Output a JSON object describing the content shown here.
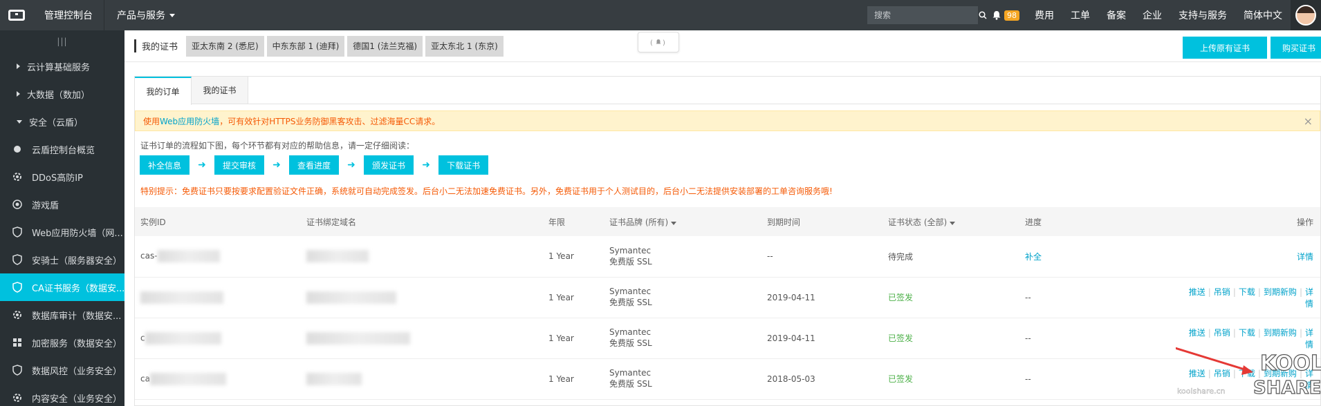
{
  "topbar": {
    "console": "管理控制台",
    "products": "产品与服务",
    "search_placeholder": "搜索",
    "notif_count": "98",
    "links": [
      "费用",
      "工单",
      "备案",
      "企业",
      "支持与服务",
      "简体中文"
    ]
  },
  "sidebar": {
    "collapse": "|||",
    "groups": [
      "云计算基础服务",
      "大数据（数加）",
      "安全（云盾）"
    ],
    "items": [
      {
        "label": "云盾控制台概览",
        "icon": "dot-icon"
      },
      {
        "label": "DDoS高防IP",
        "icon": "gear-icon"
      },
      {
        "label": "游戏盾",
        "icon": "eye-icon"
      },
      {
        "label": "Web应用防火墙（网...",
        "icon": "shield-icon"
      },
      {
        "label": "安骑士（服务器安全）",
        "icon": "shield-icon"
      },
      {
        "label": "CA证书服务（数据安...",
        "icon": "shield-icon"
      },
      {
        "label": "数据库审计（数据安...",
        "icon": "gear-icon"
      },
      {
        "label": "加密服务（数据安全）",
        "icon": "grid-icon"
      },
      {
        "label": "数据风控（业务安全）",
        "icon": "shield-icon"
      },
      {
        "label": "内容安全（业务安全）",
        "icon": "gear-icon"
      }
    ]
  },
  "header": {
    "title": "我的证书",
    "regions": [
      "亚太东南 2 (悉尼)",
      "中东东部 1 (迪拜)",
      "德国1 (法兰克福)",
      "亚太东北 1 (东京)"
    ],
    "upload_btn": "上传原有证书",
    "buy_btn": "购买证书"
  },
  "tabs": [
    "我的订单",
    "我的证书"
  ],
  "warn": {
    "pre": "使用",
    "link": "Web应用防火墙",
    "post": "，可有效针对HTTPS业务防御黑客攻击、过滤海量CC请求。"
  },
  "flow": {
    "desc": "证书订单的流程如下图，每个环节都有对应的帮助信息，请一定仔细阅读：",
    "steps": [
      "补全信息",
      "提交审核",
      "查看进度",
      "颁发证书",
      "下载证书"
    ]
  },
  "tip": "特别提示：免费证书只要按要求配置验证文件正确，系统就可自动完成签发。后台小二无法加速免费证书。另外，免费证书用于个人测试目的，后台小二无法提供安装部署的工单咨询服务哦!",
  "table": {
    "headers": [
      "实例ID",
      "证书绑定域名",
      "年限",
      "证书品牌 (所有)",
      "到期时间",
      "证书状态 (全部)",
      "进度",
      "操作"
    ],
    "rows": [
      {
        "id": "cas-",
        "years": "1 Year",
        "brand1": "Symantec",
        "brand2": "免费版 SSL",
        "expire": "--",
        "status": "待完成",
        "progress": "补全",
        "ops": [
          "详情"
        ]
      },
      {
        "id": "",
        "years": "1 Year",
        "brand1": "Symantec",
        "brand2": "免费版 SSL",
        "expire": "2019-04-11",
        "status": "已签发",
        "progress": "--",
        "ops": [
          "推送",
          "吊销",
          "下载",
          "到期新购",
          "详情"
        ]
      },
      {
        "id": "c",
        "years": "1 Year",
        "brand1": "Symantec",
        "brand2": "免费版 SSL",
        "expire": "2019-04-11",
        "status": "已签发",
        "progress": "--",
        "ops": [
          "推送",
          "吊销",
          "下载",
          "到期新购",
          "详情"
        ]
      },
      {
        "id": "ca",
        "years": "1 Year",
        "brand1": "Symantec",
        "brand2": "免费版 SSL",
        "expire": "2018-05-03",
        "status": "已签发",
        "progress": "--",
        "ops": [
          "推送",
          "吊销",
          "下载",
          "到期新购",
          "详情"
        ]
      }
    ]
  },
  "watermark": {
    "line1": "KOOL",
    "line2": "SHARE",
    "site": "koolshare.cn"
  },
  "colors": {
    "accent": "#00c1de",
    "topbar": "#373d41",
    "sidebar": "#293034",
    "warn": "#f55a06",
    "success": "#4cb048"
  }
}
